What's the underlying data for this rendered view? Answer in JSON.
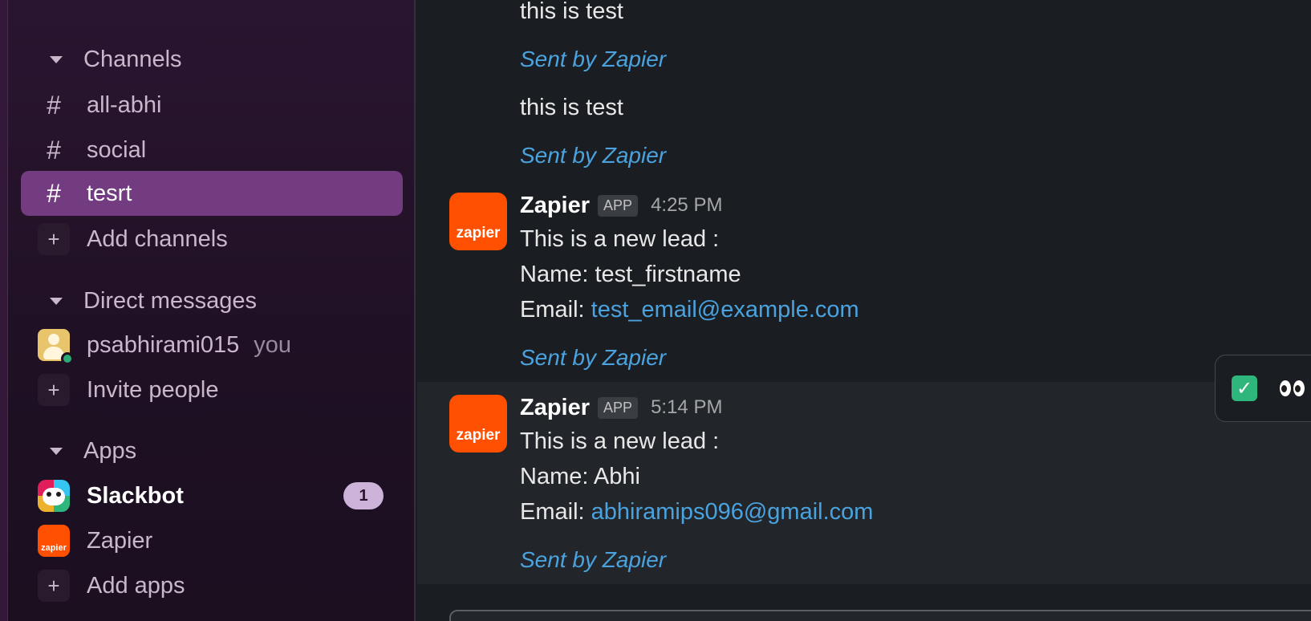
{
  "sidebar": {
    "channels_header": "Channels",
    "channels": [
      {
        "label": "all-abhi",
        "icon": "hash"
      },
      {
        "label": "social",
        "icon": "hash"
      },
      {
        "label": "tesrt",
        "icon": "hash",
        "active": true
      }
    ],
    "add_channels": "Add channels",
    "dm_header": "Direct messages",
    "dm_user": "psabhirami015",
    "dm_you": "you",
    "invite_people": "Invite people",
    "apps_header": "Apps",
    "apps": [
      {
        "label": "Slackbot",
        "badge": "1",
        "bold": true
      },
      {
        "label": "Zapier"
      }
    ],
    "add_apps": "Add apps",
    "hash_symbol": "#",
    "plus_symbol": "+",
    "zapier_logo_text": "zapier"
  },
  "messages": {
    "top": [
      {
        "text": "this is test",
        "footer": "Sent by Zapier"
      },
      {
        "text": "this is test",
        "footer": "Sent by Zapier"
      }
    ],
    "posts": [
      {
        "sender": "Zapier",
        "tag": "APP",
        "time": "4:25 PM",
        "line1": "This is a new lead :",
        "line2": "Name: test_firstname",
        "email_label": "Email: ",
        "email": "test_email@example.com",
        "footer": "Sent by Zapier"
      },
      {
        "sender": "Zapier",
        "tag": "APP",
        "time": "5:14 PM",
        "line1": "This is a new lead :",
        "line2": "Name: Abhi",
        "email_label": "Email: ",
        "email": "abhiramips096@gmail.com",
        "footer": "Sent by Zapier"
      }
    ]
  },
  "reactions": {
    "check_glyph": "✓",
    "items": [
      "white-check-mark-icon",
      "eyes-icon"
    ]
  },
  "colors": {
    "sidebar_active": "#733b80",
    "link": "#4aa3df",
    "zapier_orange": "#ff4f00",
    "online": "#2bac76",
    "badge": "#cdb2d9"
  }
}
